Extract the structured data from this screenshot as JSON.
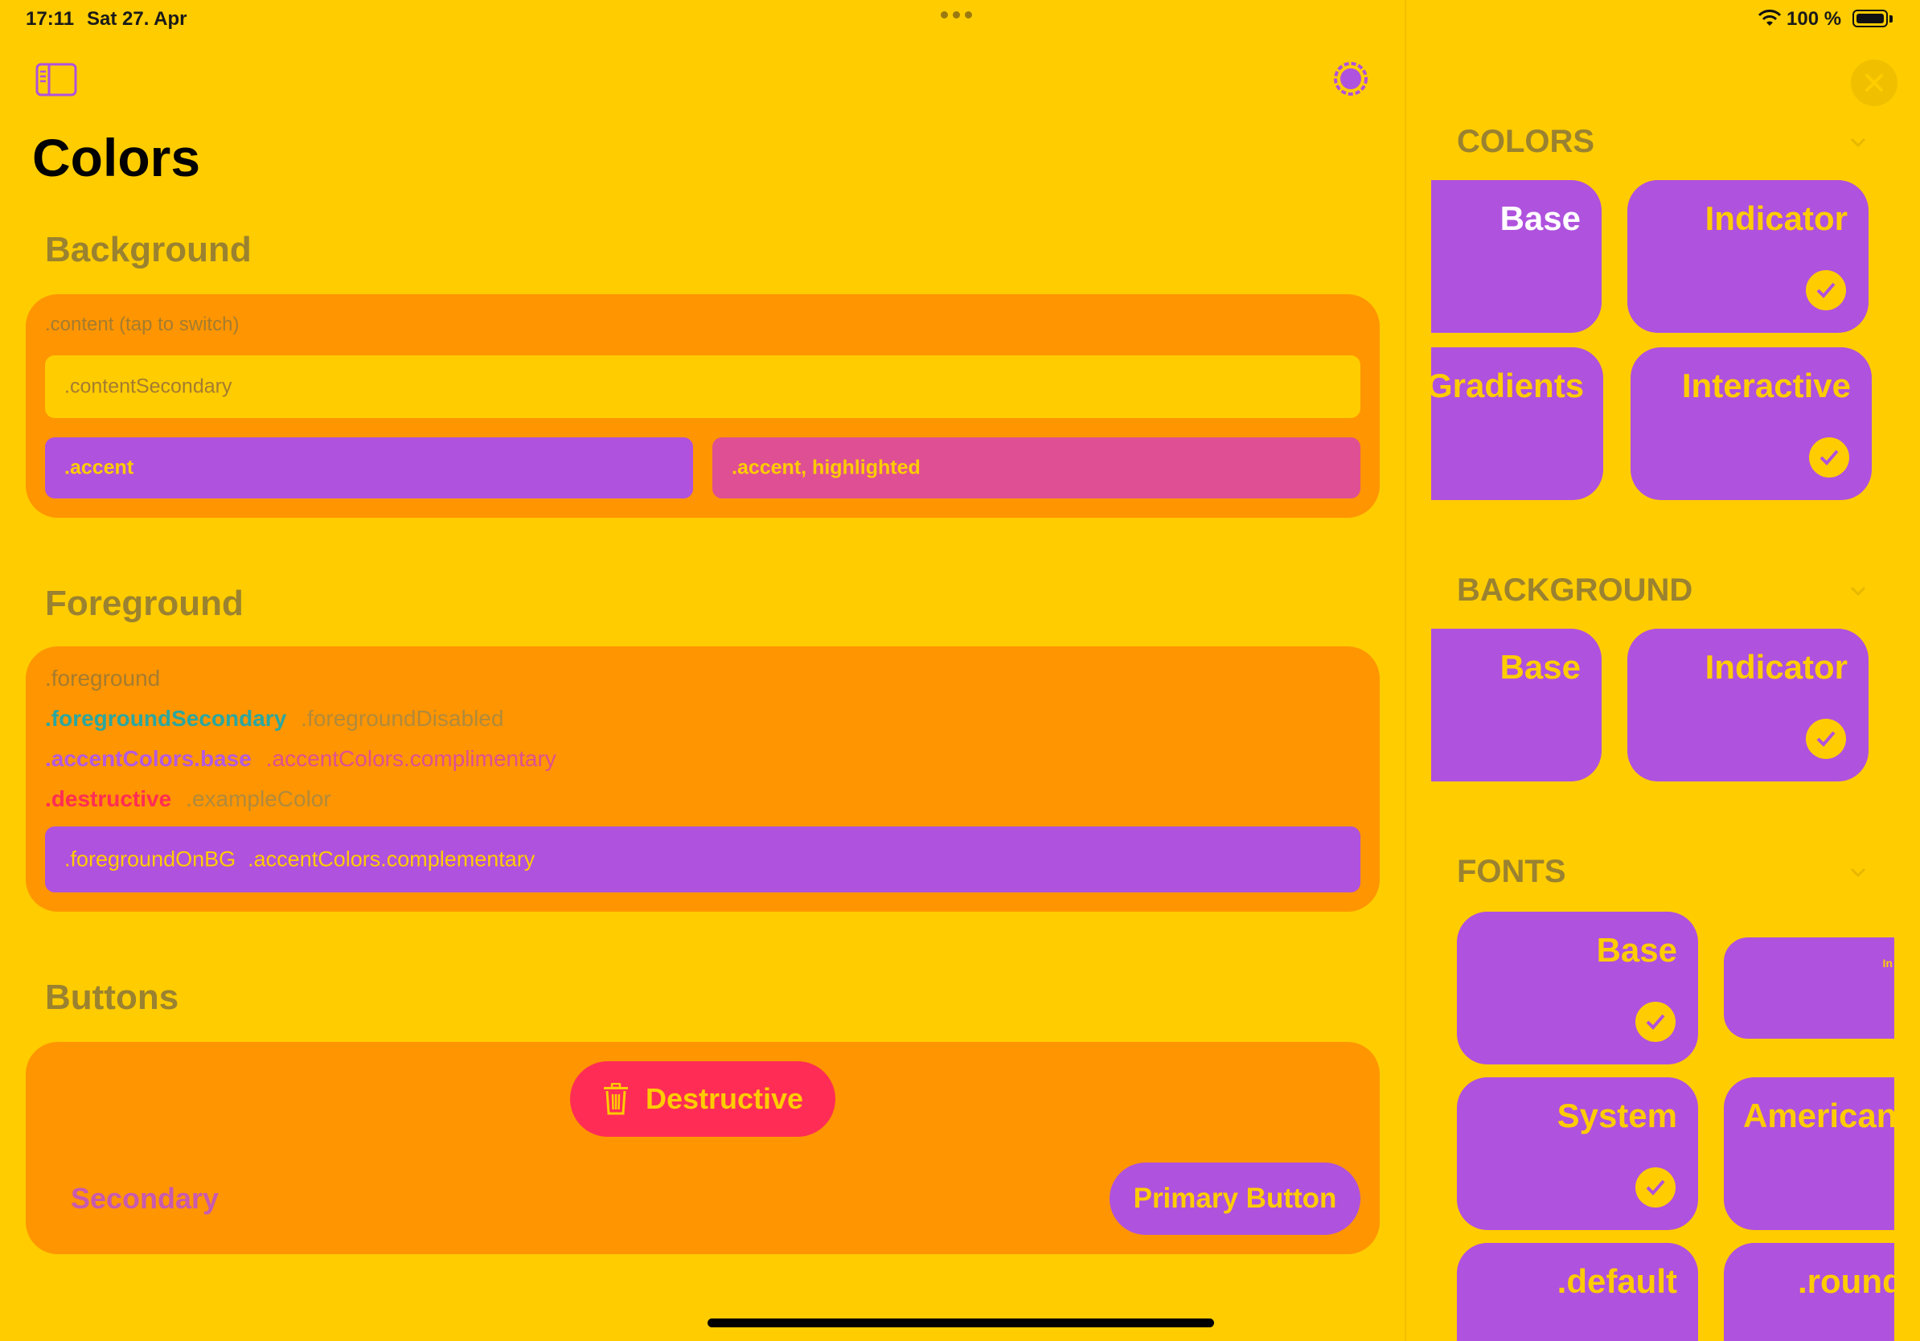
{
  "status_bar": {
    "time": "17:11",
    "date": "Sat 27. Apr",
    "battery": "100 %"
  },
  "colors": {
    "background": "#FFCC00",
    "card": "#FF9500",
    "accent": "#AF52DE",
    "accent_highlighted": "#DE5093",
    "destructive": "#FF2D55"
  },
  "toolbar": {
    "sidebar_icon": "sidebar-toggle-icon",
    "settings_icon": "gear-badge-icon"
  },
  "page_title": "Colors",
  "background_section": {
    "title": "Background",
    "content_label": ".content (tap to switch)",
    "content_secondary": ".contentSecondary",
    "accent": ".accent",
    "accent_highlighted": ".accent, highlighted"
  },
  "foreground_section": {
    "title": "Foreground",
    "foreground": ".foreground",
    "foreground_secondary": ".foregroundSecondary",
    "foreground_disabled": ".foregroundDisabled",
    "accent_base": ".accentColors.base",
    "accent_complimentary": ".accentColors.complimentary",
    "destructive": ".destructive",
    "example_color": ".exampleColor",
    "on_bg": ".foregroundOnBG",
    "on_bg_complementary": ".accentColors.complementary",
    "colors": {
      "secondary": "#2BA7A0",
      "disabled": "#B08A3C",
      "accent_base": "#B45ADF",
      "complimentary": "#DE5093",
      "destructive": "#FF2D55"
    }
  },
  "buttons_section": {
    "title": "Buttons",
    "destructive_label": "Destructive",
    "destructive_icon": "trash-icon",
    "secondary_label": "Secondary",
    "primary_label": "Primary Button"
  },
  "sidebar": {
    "close_icon": "close-icon",
    "colors_header": "COLORS",
    "colors_tiles": [
      {
        "label": "Base",
        "checked": false
      },
      {
        "label": "Indicator",
        "checked": true
      },
      {
        "label": "Gradients",
        "checked": false
      },
      {
        "label": "Interactive",
        "checked": true
      }
    ],
    "background_header": "BACKGROUND",
    "background_tiles": [
      {
        "label": "Base",
        "checked": false
      },
      {
        "label": "Indicator",
        "checked": true
      }
    ],
    "fonts_header": "FONTS",
    "fonts_tiles": [
      {
        "label": "Base",
        "checked": true
      },
      {
        "label": "In",
        "checked": false
      },
      {
        "label": "System",
        "checked": true
      },
      {
        "label": "American",
        "checked": false
      },
      {
        "label": ".default",
        "checked": false
      },
      {
        "label": ".round",
        "checked": false
      }
    ]
  }
}
